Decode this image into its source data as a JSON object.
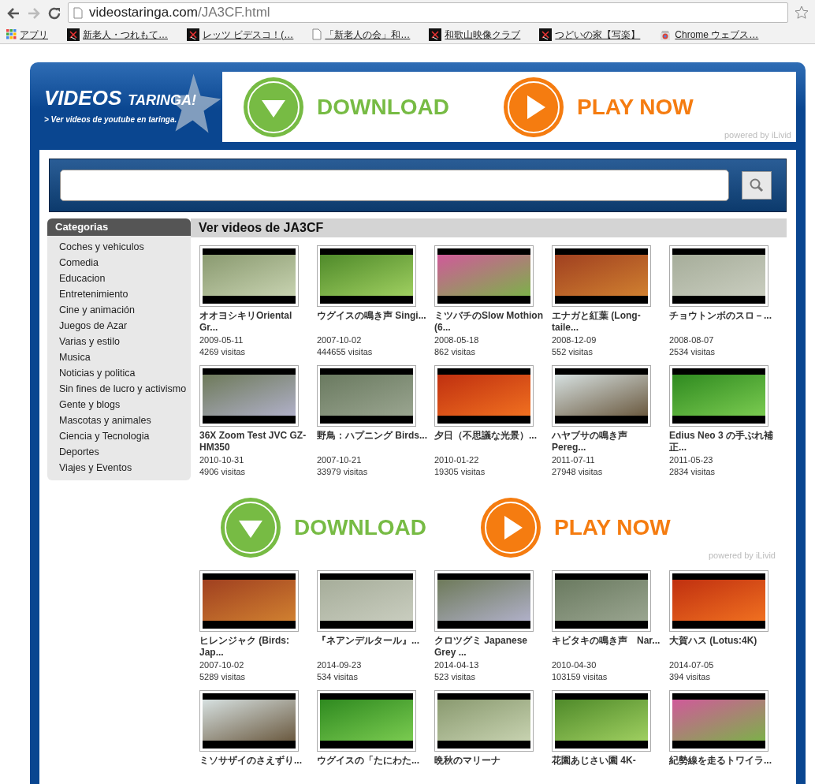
{
  "browser": {
    "url_host": "videostaringa.com",
    "url_path": "/JA3CF.html",
    "bookmarks": [
      {
        "kind": "apps",
        "label": "アプリ"
      },
      {
        "kind": "site",
        "label": "新老人・つれもて…"
      },
      {
        "kind": "site",
        "label": "レッツ ビデスコ！(…"
      },
      {
        "kind": "page",
        "label": "「新老人の会」和…"
      },
      {
        "kind": "site",
        "label": "和歌山映像クラブ"
      },
      {
        "kind": "site",
        "label": "つどいの家【写楽】"
      },
      {
        "kind": "store",
        "label": "Chrome ウェブス…"
      }
    ]
  },
  "header": {
    "logo_word_1": "VIDEOS",
    "logo_word_2": "TARINGA!",
    "logo_tagline": "> Ver videos de youtube en taringa.",
    "ad": {
      "download": "DOWNLOAD",
      "play": "PLAY NOW",
      "powered": "powered by iLivid"
    }
  },
  "sidebar": {
    "title": "Categorias",
    "items": [
      "Coches y vehiculos",
      "Comedia",
      "Educacion",
      "Entretenimiento",
      "Cine y animación",
      "Juegos de Azar",
      "Varias y estilo",
      "Musica",
      "Noticias y politica",
      "Sin fines de lucro y activismo",
      "Gente y blogs",
      "Mascotas y animales",
      "Ciencia y Tecnologia",
      "Deportes",
      "Viajes y Eventos"
    ]
  },
  "main": {
    "heading": "Ver videos de JA3CF",
    "videos": [
      {
        "title": "オオヨシキリOriental Gr...",
        "date": "2009-05-11",
        "visits": "4269 visitas"
      },
      {
        "title": "ウグイスの鳴き声 Singi...",
        "date": "2007-10-02",
        "visits": "444655 visitas"
      },
      {
        "title": "ミツバチのSlow Mothion (6...",
        "date": "2008-05-18",
        "visits": "862 visitas"
      },
      {
        "title": "エナガと紅葉 (Long-taile...",
        "date": "2008-12-09",
        "visits": "552 visitas"
      },
      {
        "title": "チョウトンボのスロ－...",
        "date": "2008-08-07",
        "visits": "2534 visitas"
      },
      {
        "title": "36X Zoom Test JVC GZ-HM350",
        "date": "2010-10-31",
        "visits": "4906 visitas"
      },
      {
        "title": "野鳥：ハプニング Birds...",
        "date": "2007-10-21",
        "visits": "33979 visitas"
      },
      {
        "title": "夕日（不思議な光景）...",
        "date": "2010-01-22",
        "visits": "19305 visitas"
      },
      {
        "title": "ハヤブサの鳴き声 Pereg...",
        "date": "2011-07-11",
        "visits": "27948 visitas"
      },
      {
        "title": "Edius Neo 3 の手ぶれ補正...",
        "date": "2011-05-23",
        "visits": "2834 visitas"
      }
    ],
    "ad": {
      "download": "DOWNLOAD",
      "play": "PLAY NOW",
      "powered": "powered by iLivid"
    },
    "more_videos": [
      {
        "title": "ヒレンジャク (Birds: Jap...",
        "date": "2007-10-02",
        "visits": "5289 visitas"
      },
      {
        "title": "『ネアンデルタール』...",
        "date": "2014-09-23",
        "visits": "534 visitas"
      },
      {
        "title": "クロツグミ Japanese Grey ...",
        "date": "2014-04-13",
        "visits": "523 visitas"
      },
      {
        "title": "キビタキの鳴き声　Nar...",
        "date": "2010-04-30",
        "visits": "103159 visitas"
      },
      {
        "title": "大賀ハス (Lotus:4K)",
        "date": "2014-07-05",
        "visits": "394 visitas"
      },
      {
        "title": "ミソサザイのさえずり..."
      },
      {
        "title": "ウグイスの「たにわた..."
      },
      {
        "title": "晩秋のマリーナ"
      },
      {
        "title": "花園あじさい園 4K-"
      },
      {
        "title": "紀勢線を走るトワイラ..."
      }
    ]
  }
}
